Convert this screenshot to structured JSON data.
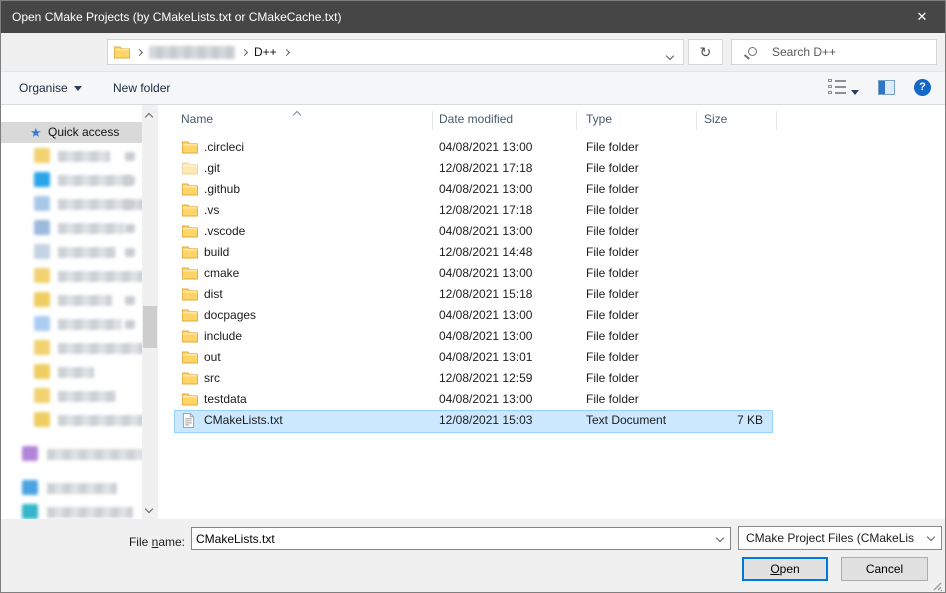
{
  "window": {
    "title": "Open CMake Projects (by CMakeLists.txt or CMakeCache.txt)"
  },
  "icons": {
    "close": "✕",
    "back": "←",
    "forward": "→",
    "up": "↑",
    "refresh": "↻",
    "quick_access_star": "★",
    "help": "?"
  },
  "nav": {
    "breadcrumb": {
      "visible_segment": "D++"
    },
    "search_placeholder": "Search D++"
  },
  "toolbar": {
    "organise_label": "Organise",
    "new_folder_label": "New folder"
  },
  "sidebar": {
    "quick_access_label": "Quick access",
    "items": [
      {
        "icon": "folder-icon",
        "color": "#f2d170",
        "label_w": 52,
        "pinned": true,
        "top_level": false,
        "group_gap": false
      },
      {
        "icon": "desktop-icon",
        "color": "#2aa5ea",
        "label_w": 74,
        "pinned": true,
        "top_level": false,
        "group_gap": false
      },
      {
        "icon": "downloads-icon",
        "color": "#a9c8e8",
        "label_w": 88,
        "pinned": true,
        "top_level": false,
        "group_gap": false
      },
      {
        "icon": "documents-icon",
        "color": "#9db9dd",
        "label_w": 66,
        "pinned": true,
        "top_level": false,
        "group_gap": false
      },
      {
        "icon": "pictures-icon",
        "color": "#c4d3e2",
        "label_w": 58,
        "pinned": true,
        "top_level": false,
        "group_gap": false
      },
      {
        "icon": "folder-icon",
        "color": "#f2d170",
        "label_w": 92,
        "pinned": false,
        "top_level": false,
        "group_gap": false
      },
      {
        "icon": "folder-icon",
        "color": "#eecd62",
        "label_w": 54,
        "pinned": true,
        "top_level": false,
        "group_gap": false
      },
      {
        "icon": "folder-icon",
        "color": "#aacdf0",
        "label_w": 64,
        "pinned": true,
        "top_level": false,
        "group_gap": false
      },
      {
        "icon": "folder-icon",
        "color": "#f2d170",
        "label_w": 96,
        "pinned": false,
        "top_level": false,
        "group_gap": false
      },
      {
        "icon": "folder-icon",
        "color": "#eecd62",
        "label_w": 36,
        "pinned": false,
        "top_level": false,
        "group_gap": false
      },
      {
        "icon": "folder-icon",
        "color": "#f2d170",
        "label_w": 58,
        "pinned": false,
        "top_level": false,
        "group_gap": false
      },
      {
        "icon": "folder-icon",
        "color": "#eecd62",
        "label_w": 112,
        "pinned": false,
        "top_level": false,
        "group_gap": false
      },
      {
        "icon": "cloud-icon",
        "color": "#b184d8",
        "label_w": 132,
        "pinned": false,
        "top_level": true,
        "group_gap": true
      },
      {
        "icon": "computer-icon",
        "color": "#4ba4e2",
        "label_w": 70,
        "pinned": false,
        "top_level": true,
        "group_gap": true
      },
      {
        "icon": "network-icon",
        "color": "#35b5cb",
        "label_w": 86,
        "pinned": false,
        "top_level": true,
        "group_gap": false
      }
    ]
  },
  "list": {
    "columns": [
      "Name",
      "Date modified",
      "Type",
      "Size"
    ],
    "files": [
      {
        "name": ".circleci",
        "date_modified": "04/08/2021 13:00",
        "type": "File folder",
        "size": "",
        "icon": "folder",
        "hidden": false,
        "selected": false
      },
      {
        "name": ".git",
        "date_modified": "12/08/2021 17:18",
        "type": "File folder",
        "size": "",
        "icon": "folder",
        "hidden": true,
        "selected": false
      },
      {
        "name": ".github",
        "date_modified": "04/08/2021 13:00",
        "type": "File folder",
        "size": "",
        "icon": "folder",
        "hidden": false,
        "selected": false
      },
      {
        "name": ".vs",
        "date_modified": "12/08/2021 17:18",
        "type": "File folder",
        "size": "",
        "icon": "folder",
        "hidden": false,
        "selected": false
      },
      {
        "name": ".vscode",
        "date_modified": "04/08/2021 13:00",
        "type": "File folder",
        "size": "",
        "icon": "folder",
        "hidden": false,
        "selected": false
      },
      {
        "name": "build",
        "date_modified": "12/08/2021 14:48",
        "type": "File folder",
        "size": "",
        "icon": "folder",
        "hidden": false,
        "selected": false
      },
      {
        "name": "cmake",
        "date_modified": "04/08/2021 13:00",
        "type": "File folder",
        "size": "",
        "icon": "folder",
        "hidden": false,
        "selected": false
      },
      {
        "name": "dist",
        "date_modified": "12/08/2021 15:18",
        "type": "File folder",
        "size": "",
        "icon": "folder",
        "hidden": false,
        "selected": false
      },
      {
        "name": "docpages",
        "date_modified": "04/08/2021 13:00",
        "type": "File folder",
        "size": "",
        "icon": "folder",
        "hidden": false,
        "selected": false
      },
      {
        "name": "include",
        "date_modified": "04/08/2021 13:00",
        "type": "File folder",
        "size": "",
        "icon": "folder",
        "hidden": false,
        "selected": false
      },
      {
        "name": "out",
        "date_modified": "04/08/2021 13:01",
        "type": "File folder",
        "size": "",
        "icon": "folder",
        "hidden": false,
        "selected": false
      },
      {
        "name": "src",
        "date_modified": "12/08/2021 12:59",
        "type": "File folder",
        "size": "",
        "icon": "folder",
        "hidden": false,
        "selected": false
      },
      {
        "name": "testdata",
        "date_modified": "04/08/2021 13:00",
        "type": "File folder",
        "size": "",
        "icon": "folder",
        "hidden": false,
        "selected": false
      },
      {
        "name": "CMakeLists.txt",
        "date_modified": "12/08/2021 15:03",
        "type": "Text Document",
        "size": "7 KB",
        "icon": "text-file",
        "hidden": false,
        "selected": true
      }
    ]
  },
  "footer": {
    "file_name_label_parts": [
      "File ",
      "n",
      "ame:"
    ],
    "file_name_value": "CMakeLists.txt",
    "file_type_filter": "CMake Project Files  (CMakeLis",
    "open_label_parts": [
      "O",
      "pen"
    ],
    "cancel_label": "Cancel"
  },
  "colors": {
    "titlebar_bg": "#464646",
    "selection_bg": "#cce8ff",
    "selection_border": "#99d1ff",
    "accent_blue": "#0078d7",
    "help_blue": "#1467c6",
    "quick_access_star": "#3a7bd5",
    "folder_yellow": "#ffd567",
    "folder_outline": "#e0a93e"
  }
}
